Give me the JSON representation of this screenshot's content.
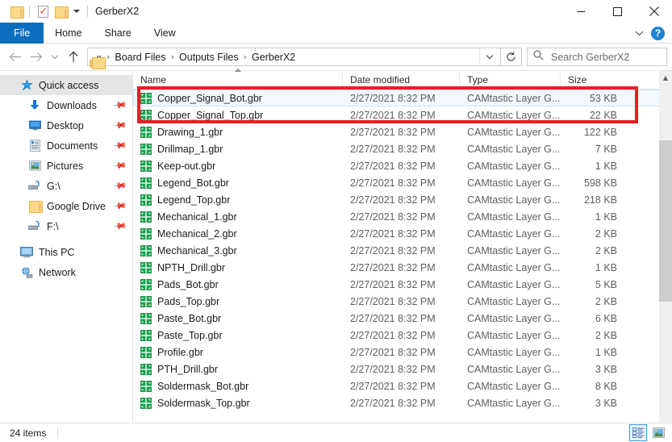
{
  "window": {
    "title": "GerberX2",
    "quick_access": [
      {
        "name": "save-icon",
        "label": "Save"
      },
      {
        "name": "properties-icon",
        "label": "Properties"
      },
      {
        "name": "new-folder-icon",
        "label": "New folder"
      },
      {
        "name": "customize-caret-icon",
        "label": "Customize Quick Access Toolbar"
      }
    ],
    "controls": {
      "minimize": "Minimize",
      "maximize": "Maximize",
      "close": "Close"
    }
  },
  "ribbon": {
    "tabs": [
      {
        "label": "File"
      },
      {
        "label": "Home"
      },
      {
        "label": "Share"
      },
      {
        "label": "View"
      }
    ],
    "expand_label": "Expand the Ribbon",
    "help_label": "?"
  },
  "address": {
    "back_label": "Back",
    "forward_label": "Forward",
    "recent_label": "Recent locations",
    "up_label": "Up",
    "overflow": "«",
    "crumbs": [
      "Board Files",
      "Outputs Files",
      "GerberX2"
    ],
    "separator": "›",
    "dropdown_label": "Previous locations",
    "refresh_label": "Refresh",
    "search": {
      "placeholder": "Search GerberX2",
      "value": ""
    }
  },
  "sidebar": {
    "items": [
      {
        "label": "Quick access",
        "icon": "quick-access-star-icon",
        "level": 0,
        "selected": true,
        "pinned": false
      },
      {
        "label": "Downloads",
        "icon": "downloads-arrow-icon",
        "level": 1,
        "selected": false,
        "pinned": true
      },
      {
        "label": "Desktop",
        "icon": "desktop-monitor-icon",
        "level": 1,
        "selected": false,
        "pinned": true
      },
      {
        "label": "Documents",
        "icon": "documents-icon",
        "level": 1,
        "selected": false,
        "pinned": true
      },
      {
        "label": "Pictures",
        "icon": "pictures-icon",
        "level": 1,
        "selected": false,
        "pinned": true
      },
      {
        "label": "G:\\",
        "icon": "network-drive-icon",
        "level": 1,
        "selected": false,
        "pinned": true
      },
      {
        "label": "Google Drive",
        "icon": "folder-icon",
        "level": 1,
        "selected": false,
        "pinned": true
      },
      {
        "label": "F:\\",
        "icon": "network-drive-icon",
        "level": 1,
        "selected": false,
        "pinned": true
      },
      {
        "label": "This PC",
        "icon": "this-pc-icon",
        "level": 0,
        "selected": false,
        "pinned": false
      },
      {
        "label": "Network",
        "icon": "network-icon",
        "level": 0,
        "selected": false,
        "pinned": false
      }
    ]
  },
  "filelist": {
    "columns": [
      {
        "label": "Name",
        "sorted": "asc"
      },
      {
        "label": "Date modified",
        "sorted": ""
      },
      {
        "label": "Type",
        "sorted": ""
      },
      {
        "label": "Size",
        "sorted": ""
      }
    ],
    "rows": [
      {
        "name": "Copper_Signal_Bot.gbr",
        "date": "2/27/2021 8:32 PM",
        "type": "CAMtastic Layer G...",
        "size": "53 KB",
        "selected": true
      },
      {
        "name": "Copper_Signal_Top.gbr",
        "date": "2/27/2021 8:32 PM",
        "type": "CAMtastic Layer G...",
        "size": "22 KB",
        "selected": false
      },
      {
        "name": "Drawing_1.gbr",
        "date": "2/27/2021 8:32 PM",
        "type": "CAMtastic Layer G...",
        "size": "122 KB",
        "selected": false
      },
      {
        "name": "Drillmap_1.gbr",
        "date": "2/27/2021 8:32 PM",
        "type": "CAMtastic Layer G...",
        "size": "7 KB",
        "selected": false
      },
      {
        "name": "Keep-out.gbr",
        "date": "2/27/2021 8:32 PM",
        "type": "CAMtastic Layer G...",
        "size": "1 KB",
        "selected": false
      },
      {
        "name": "Legend_Bot.gbr",
        "date": "2/27/2021 8:32 PM",
        "type": "CAMtastic Layer G...",
        "size": "598 KB",
        "selected": false
      },
      {
        "name": "Legend_Top.gbr",
        "date": "2/27/2021 8:32 PM",
        "type": "CAMtastic Layer G...",
        "size": "218 KB",
        "selected": false
      },
      {
        "name": "Mechanical_1.gbr",
        "date": "2/27/2021 8:32 PM",
        "type": "CAMtastic Layer G...",
        "size": "1 KB",
        "selected": false
      },
      {
        "name": "Mechanical_2.gbr",
        "date": "2/27/2021 8:32 PM",
        "type": "CAMtastic Layer G...",
        "size": "2 KB",
        "selected": false
      },
      {
        "name": "Mechanical_3.gbr",
        "date": "2/27/2021 8:32 PM",
        "type": "CAMtastic Layer G...",
        "size": "2 KB",
        "selected": false
      },
      {
        "name": "NPTH_Drill.gbr",
        "date": "2/27/2021 8:32 PM",
        "type": "CAMtastic Layer G...",
        "size": "1 KB",
        "selected": false
      },
      {
        "name": "Pads_Bot.gbr",
        "date": "2/27/2021 8:32 PM",
        "type": "CAMtastic Layer G...",
        "size": "5 KB",
        "selected": false
      },
      {
        "name": "Pads_Top.gbr",
        "date": "2/27/2021 8:32 PM",
        "type": "CAMtastic Layer G...",
        "size": "2 KB",
        "selected": false
      },
      {
        "name": "Paste_Bot.gbr",
        "date": "2/27/2021 8:32 PM",
        "type": "CAMtastic Layer G...",
        "size": "6 KB",
        "selected": false
      },
      {
        "name": "Paste_Top.gbr",
        "date": "2/27/2021 8:32 PM",
        "type": "CAMtastic Layer G...",
        "size": "2 KB",
        "selected": false
      },
      {
        "name": "Profile.gbr",
        "date": "2/27/2021 8:32 PM",
        "type": "CAMtastic Layer G...",
        "size": "1 KB",
        "selected": false
      },
      {
        "name": "PTH_Drill.gbr",
        "date": "2/27/2021 8:32 PM",
        "type": "CAMtastic Layer G...",
        "size": "3 KB",
        "selected": false
      },
      {
        "name": "Soldermask_Bot.gbr",
        "date": "2/27/2021 8:32 PM",
        "type": "CAMtastic Layer G...",
        "size": "8 KB",
        "selected": false
      },
      {
        "name": "Soldermask_Top.gbr",
        "date": "2/27/2021 8:32 PM",
        "type": "CAMtastic Layer G...",
        "size": "3 KB",
        "selected": false
      }
    ]
  },
  "annotation": {
    "color": "#ee1c25",
    "label": "highlight-copper-signal-files"
  },
  "statusbar": {
    "item_count": "24 items",
    "views": [
      {
        "name": "details-view-button",
        "label": "Details view",
        "active": true
      },
      {
        "name": "large-icons-view-button",
        "label": "Large icons view",
        "active": false
      }
    ]
  }
}
